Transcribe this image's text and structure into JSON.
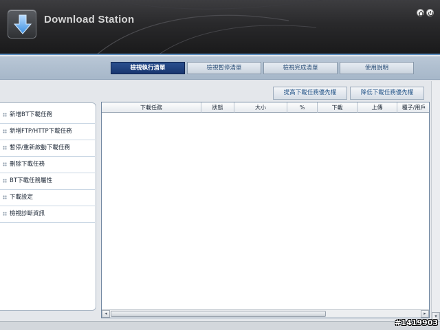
{
  "header": {
    "app_title": "Download Station",
    "icons": [
      "home-icon",
      "logout-icon"
    ]
  },
  "tabs": [
    {
      "label": "檢視執行清單",
      "active": true
    },
    {
      "label": "檢視暫停清單",
      "active": false
    },
    {
      "label": "檢視完成清單",
      "active": false
    },
    {
      "label": "使用說明",
      "active": false
    }
  ],
  "priority_buttons": {
    "raise": "提高下載任務優先權",
    "lower": "降低下載任務優先權"
  },
  "sidebar": {
    "items": [
      "新增BT下載任務",
      "新增FTP/HTTP下載任務",
      "暫停/重新啟動下載任務",
      "刪除下載任務",
      "BT下載任務屬性",
      "下載設定",
      "檢視診斷資訊"
    ]
  },
  "table": {
    "columns": [
      "下載任務",
      "狀態",
      "大小",
      "%",
      "下載",
      "上傳",
      "種子/用戶"
    ],
    "rows": []
  },
  "watermark": "#1419903",
  "colors": {
    "accent": "#1c3b78",
    "header_bg": "#2a2a2c",
    "tab_band": "#aebdcd"
  }
}
